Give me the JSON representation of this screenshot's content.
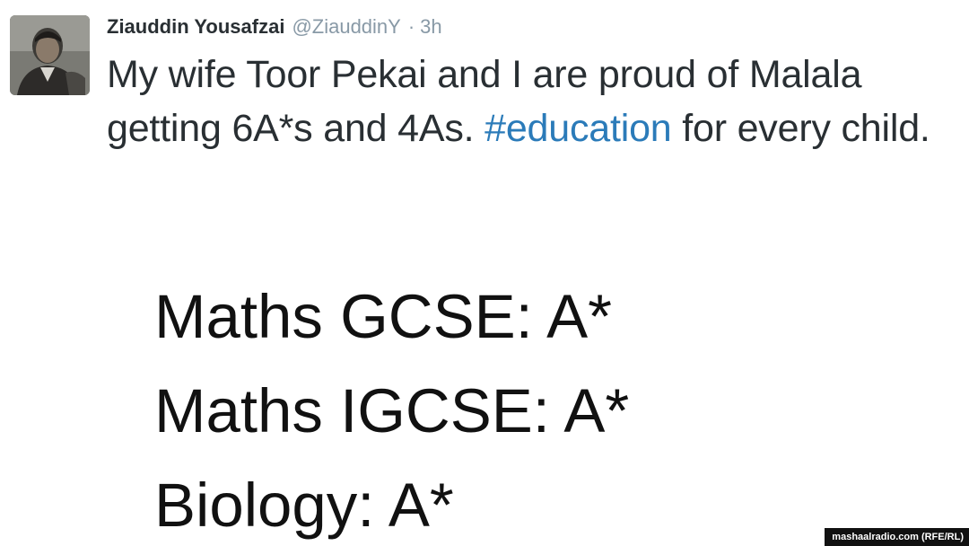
{
  "tweet": {
    "author": {
      "display_name": "Ziauddin Yousafzai",
      "screen_name": "@ZiauddinY",
      "separator": "·",
      "time": "3h",
      "avatar_icon": "user-photo-avatar"
    },
    "text": {
      "part1": "My wife Toor Pekai and I are proud of Malala getting 6A*s and 4As. ",
      "hashtag": "#education",
      "part2": " for every child."
    },
    "colors": {
      "hashtag": "#2b7bb9",
      "meta": "#8899a6",
      "text": "#292f33"
    }
  },
  "grades": [
    "Maths GCSE: A*",
    "Maths IGCSE: A*",
    "Biology: A*"
  ],
  "watermark": "mashaalradio.com (RFE/RL)"
}
